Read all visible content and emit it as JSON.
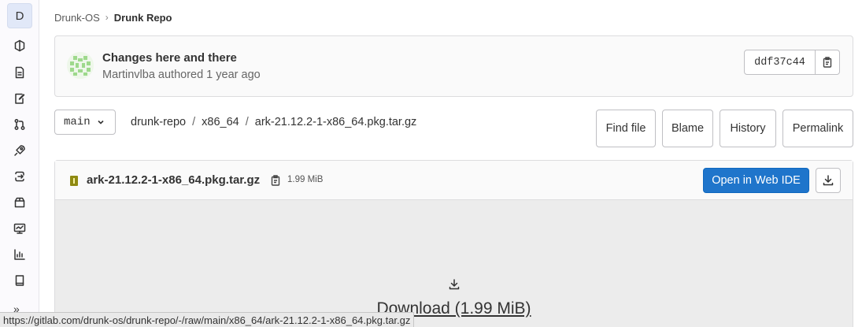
{
  "sidebar": {
    "project_initial": "D",
    "collapse_glyph": "»",
    "items": [
      {
        "name": "project-overview-icon"
      },
      {
        "name": "repository-icon"
      },
      {
        "name": "issues-icon"
      },
      {
        "name": "merge-requests-icon"
      },
      {
        "name": "cicd-icon"
      },
      {
        "name": "deployments-icon"
      },
      {
        "name": "packages-icon"
      },
      {
        "name": "monitor-icon"
      },
      {
        "name": "analytics-icon"
      },
      {
        "name": "wiki-icon"
      }
    ]
  },
  "breadcrumb": {
    "group": "Drunk-OS",
    "project": "Drunk Repo"
  },
  "commit": {
    "title": "Changes here and there",
    "meta": "Martinvlba authored 1 year ago",
    "sha": "ddf37c44"
  },
  "branch": {
    "name": "main"
  },
  "path": {
    "repo": "drunk-repo",
    "dir": "x86_64",
    "file": "ark-21.12.2-1-x86_64.pkg.tar.gz",
    "separator": "/"
  },
  "actions": {
    "find_file": "Find file",
    "blame": "Blame",
    "history": "History",
    "permalink": "Permalink"
  },
  "file": {
    "name": "ark-21.12.2-1-x86_64.pkg.tar.gz",
    "size": "1.99 MiB",
    "open_ide": "Open in Web IDE",
    "download_label": "Download (1.99 MiB)"
  },
  "status_bar": {
    "url": "https://gitlab.com/drunk-os/drunk-repo/-/raw/main/x86_64/ark-21.12.2-1-x86_64.pkg.tar.gz"
  },
  "colors": {
    "primary": "#1f75cb",
    "archive_icon": "#8f8a12"
  }
}
